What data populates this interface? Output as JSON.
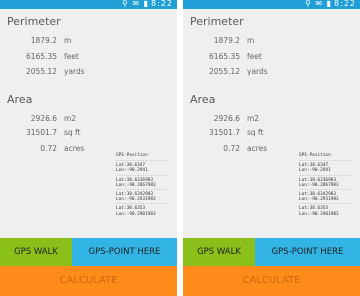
{
  "panels": [
    {
      "status": {
        "icons": "⚲ ✉ ▮",
        "time": "8:22"
      },
      "perimeter": {
        "title": "Perimeter",
        "rows": [
          {
            "value": "1879.2",
            "unit": "m"
          },
          {
            "value": "6165.35",
            "unit": "feet"
          },
          {
            "value": "2055.12",
            "unit": "yards"
          }
        ]
      },
      "area": {
        "title": "Area",
        "rows": [
          {
            "value": "2926.6",
            "unit": "m2"
          },
          {
            "value": "31501.7",
            "unit": "sq ft"
          },
          {
            "value": "0.72",
            "unit": "acres"
          }
        ]
      },
      "gps": {
        "header": "GPS-Position",
        "separator": "--------------------",
        "entries": [
          {
            "lat": "Lat:38.6347",
            "lon": "Lon:-90.2941"
          },
          {
            "lat": "Lat:38.6336983",
            "lon": "Lon:-90.2867983"
          },
          {
            "lat": "Lat:38.6342983",
            "lon": "Lon:-90.2931983"
          },
          {
            "lat": "Lat:38.6353",
            "lon": "Lon:-90.2901983"
          }
        ]
      },
      "buttons": {
        "walk": "GPS WALK",
        "point": "GPS-POINT HERE",
        "calculate": "CALCULATE"
      }
    },
    {
      "status": {
        "icons": "⚲ ✉ ▮",
        "time": "8:22"
      },
      "perimeter": {
        "title": "Perimeter",
        "rows": [
          {
            "value": "1879.2",
            "unit": "m"
          },
          {
            "value": "6165.35",
            "unit": "feet"
          },
          {
            "value": "2055.12",
            "unit": "yards"
          }
        ]
      },
      "area": {
        "title": "Area",
        "rows": [
          {
            "value": "2926.6",
            "unit": "m2"
          },
          {
            "value": "31501.7",
            "unit": "sq ft"
          },
          {
            "value": "0.72",
            "unit": "acres"
          }
        ]
      },
      "gps": {
        "header": "GPS-Position",
        "separator": "--------------------",
        "entries": [
          {
            "lat": "Lat:38.6347",
            "lon": "Lon:-90.2941"
          },
          {
            "lat": "Lat:38.6336983",
            "lon": "Lon:-90.2867983"
          },
          {
            "lat": "Lat:38.6342983",
            "lon": "Lon:-90.2931983"
          },
          {
            "lat": "Lat:38.6353",
            "lon": "Lon:-90.2901983"
          }
        ]
      },
      "buttons": {
        "walk": "GPS WALK",
        "point": "GPS-POINT HERE",
        "calculate": "CALCULATE"
      }
    }
  ],
  "colors": {
    "statusbar": "#1f9fd6",
    "walk_button": "#8bc01a",
    "point_button": "#32b5e5",
    "calculate_button": "#ff8c1a"
  }
}
